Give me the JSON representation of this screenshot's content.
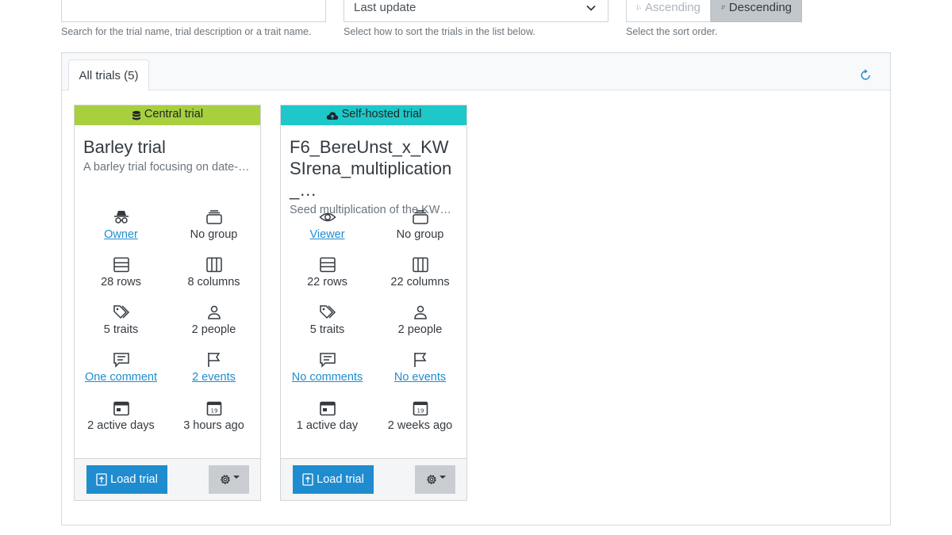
{
  "search": {
    "value": "",
    "help": "Search for the trial name, trial description or a trait name."
  },
  "sort": {
    "selected": "Last update",
    "help": "Select how to sort the trials in the list below."
  },
  "order": {
    "ascending": "Ascending",
    "descending": "Descending",
    "active": "Descending",
    "help": "Select the sort order."
  },
  "tabs": [
    {
      "label": "All trials (5)"
    }
  ],
  "colors": {
    "central": "#a8cf3e",
    "selfhosted": "#1ec8c8",
    "link": "#1f8ccf",
    "button": "#1f8ccf"
  },
  "cards": [
    {
      "badge": "Central trial",
      "badge_icon": "database-icon",
      "title": "Barley trial",
      "description": "A barley trial focusing on date-…",
      "role": "Owner",
      "role_icon": "incognito-icon",
      "group": "No group",
      "rows": "28 rows",
      "columns": "8 columns",
      "traits": "5 traits",
      "people": "2 people",
      "comments": "One comment",
      "events": "2 events",
      "active_days": "2 active days",
      "updated": "3 hours ago",
      "load_label": "Load trial"
    },
    {
      "badge": "Self-hosted trial",
      "badge_icon": "cloud-icon",
      "title": "F6_BereUnst_x_KWSIrena_multiplication_…",
      "description": "Seed multiplication of the KWS…",
      "role": "Viewer",
      "role_icon": "eye-icon",
      "group": "No group",
      "rows": "22 rows",
      "columns": "22 columns",
      "traits": "5 traits",
      "people": "2 people",
      "comments": "No comments",
      "events": "No events",
      "active_days": "1 active day",
      "updated": "2 weeks ago",
      "load_label": "Load trial"
    }
  ]
}
